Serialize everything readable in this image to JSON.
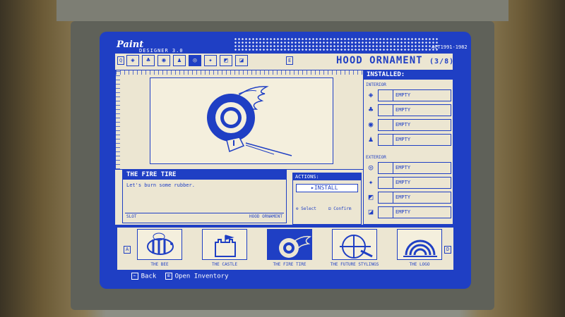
{
  "header": {
    "brand_top": "Paint",
    "brand_sub": "DESIGNER 3.0",
    "serial": "ACT1991-1982"
  },
  "toolbar": {
    "left_key": "Q",
    "right_key": "E",
    "category_title": "HOOD ORNAMENT",
    "category_count": "(3/8)",
    "tabs": [
      {
        "icon": "shield-icon",
        "glyph": "◈"
      },
      {
        "icon": "tree-icon",
        "glyph": "♣"
      },
      {
        "icon": "eye-icon",
        "glyph": "◉"
      },
      {
        "icon": "joystick-icon",
        "glyph": "♟"
      },
      {
        "icon": "tire-icon",
        "glyph": "◎",
        "selected": true
      },
      {
        "icon": "pin-icon",
        "glyph": "✦"
      },
      {
        "icon": "paint-icon",
        "glyph": "◩"
      },
      {
        "icon": "sticker-icon",
        "glyph": "◪"
      }
    ]
  },
  "installed": {
    "title": "INSTALLED:",
    "interior_label": "INTERIOR",
    "exterior_label": "EXTERIOR",
    "interior": [
      {
        "icon": "shield-icon",
        "glyph": "◈",
        "value": "EMPTY"
      },
      {
        "icon": "tree-icon",
        "glyph": "♣",
        "value": "EMPTY"
      },
      {
        "icon": "eye-icon",
        "glyph": "◉",
        "value": "EMPTY"
      },
      {
        "icon": "joystick-icon",
        "glyph": "♟",
        "value": "EMPTY"
      }
    ],
    "exterior": [
      {
        "icon": "tire-icon",
        "glyph": "◎",
        "value": "EMPTY"
      },
      {
        "icon": "pin-icon",
        "glyph": "✦",
        "value": "EMPTY"
      },
      {
        "icon": "paint-icon",
        "glyph": "◩",
        "value": "EMPTY"
      },
      {
        "icon": "sticker-icon",
        "glyph": "◪",
        "value": "EMPTY"
      }
    ]
  },
  "item": {
    "name": "THE FIRE TIRE",
    "description": "Let's burn some rubber.",
    "slot_label": "SLOT",
    "slot_value": "HOOD ORNAMENT"
  },
  "actions": {
    "title": "ACTIONS:",
    "install_label": "INSTALL",
    "select_hint": "Select",
    "confirm_hint": "Confirm"
  },
  "inventory": {
    "left_key": "A",
    "right_key": "D",
    "items": [
      {
        "label": "THE BEE",
        "icon": "bee-icon"
      },
      {
        "label": "THE CASTLE",
        "icon": "castle-icon"
      },
      {
        "label": "THE FIRE TIRE",
        "icon": "fire-tire-icon",
        "selected": true
      },
      {
        "label": "THE FUTURE STYLINGS",
        "icon": "rocket-icon"
      },
      {
        "label": "THE LOGO",
        "icon": "logo-icon"
      }
    ]
  },
  "footer": {
    "back_key": "←",
    "back_label": "Back",
    "inventory_key": "⊞",
    "inventory_label": "Open Inventory"
  }
}
